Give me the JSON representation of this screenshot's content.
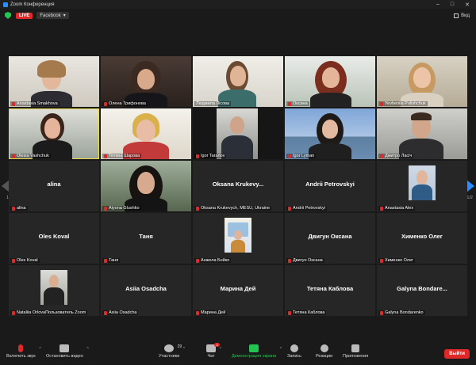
{
  "window": {
    "title": "Zoom Конференция"
  },
  "topbar": {
    "live_label": "LIVE",
    "stream_label": "Facebook",
    "view_label": "Вид"
  },
  "pages": {
    "left": "1/2",
    "right": "1/2"
  },
  "tiles": [
    {
      "label": "Anastasia Smakhova",
      "bigname": "",
      "kind": "video"
    },
    {
      "label": "Олена Трифонова",
      "bigname": "",
      "kind": "video"
    },
    {
      "label": "Людмила Лісова",
      "bigname": "",
      "kind": "video"
    },
    {
      "label": "Оксана",
      "bigname": "",
      "kind": "video"
    },
    {
      "label": "Yevheniia Polishchuk",
      "bigname": "",
      "kind": "video"
    },
    {
      "label": "Olesia Vashchuk",
      "bigname": "",
      "kind": "video"
    },
    {
      "label": "Тетяна Шарова",
      "bigname": "",
      "kind": "video"
    },
    {
      "label": "Igor Taranov",
      "bigname": "",
      "kind": "video"
    },
    {
      "label": "Igor Lyman",
      "bigname": "",
      "kind": "video"
    },
    {
      "label": "Дмитро Ласіч",
      "bigname": "",
      "kind": "video"
    },
    {
      "label": "alina",
      "bigname": "alina",
      "kind": "name"
    },
    {
      "label": "Alyona Glushko",
      "bigname": "",
      "kind": "video"
    },
    {
      "label": "Oksana Krukevych, MESU, Ukraine",
      "bigname": "Oksana  Krukevy...",
      "kind": "name"
    },
    {
      "label": "Andrii Petrovskyi",
      "bigname": "Andrii Petrovskyi",
      "kind": "name"
    },
    {
      "label": "Anastasia Alex",
      "bigname": "",
      "kind": "photo"
    },
    {
      "label": "Oles Koval",
      "bigname": "Oles Koval",
      "kind": "name"
    },
    {
      "label": "Таня",
      "bigname": "Таня",
      "kind": "name"
    },
    {
      "label": "Анжела Бойко",
      "bigname": "",
      "kind": "photo"
    },
    {
      "label": "Двигун Оксана",
      "bigname": "Двигун Оксана",
      "kind": "name"
    },
    {
      "label": "Хименко Олег",
      "bigname": "Хименко Олег",
      "kind": "name"
    },
    {
      "label": "Nataliia OrlovaПользователь Zoom",
      "bigname": "",
      "kind": "photo"
    },
    {
      "label": "Asiia Osadcha",
      "bigname": "Asiia Osadcha",
      "kind": "name"
    },
    {
      "label": "Марина Дей",
      "bigname": "Марина Дей",
      "kind": "name"
    },
    {
      "label": "Тетяна Каблова",
      "bigname": "Тетяна Каблова",
      "kind": "name"
    },
    {
      "label": "Galyna Bondarenko",
      "bigname": "Galyna  Bondare...",
      "kind": "name"
    }
  ],
  "toolbar": {
    "audio": "Включить звук",
    "video": "Остановить видео",
    "participants": "Участники",
    "participants_count": "29",
    "chat": "Чат",
    "chat_badge": "1",
    "share": "Демонстрация экрана",
    "record": "Запись",
    "reactions": "Реакции",
    "apps": "Приложения",
    "leave": "Выйти"
  },
  "colors": {
    "accent": "#2d8cff",
    "leave": "#e02828",
    "share": "#23c552",
    "active_speaker": "#e8d94a"
  }
}
